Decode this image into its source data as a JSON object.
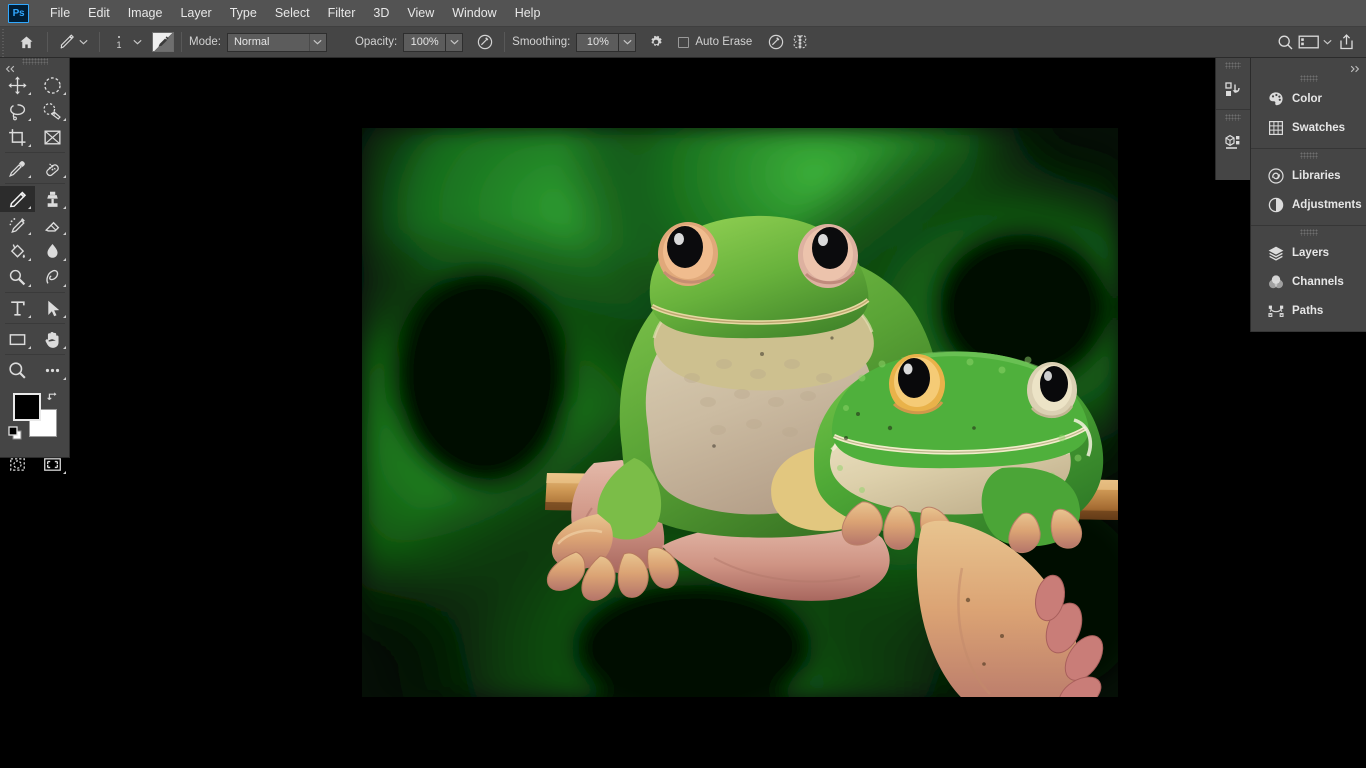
{
  "app": {
    "name": "Adobe Photoshop",
    "logo_text": "Ps",
    "accent_color": "#31a8ff",
    "chrome_color": "#535353",
    "panel_color": "#454545",
    "canvas_color": "#000000"
  },
  "menubar": {
    "items": [
      {
        "label": "File"
      },
      {
        "label": "Edit"
      },
      {
        "label": "Image"
      },
      {
        "label": "Layer"
      },
      {
        "label": "Type"
      },
      {
        "label": "Select"
      },
      {
        "label": "Filter"
      },
      {
        "label": "3D"
      },
      {
        "label": "View"
      },
      {
        "label": "Window"
      },
      {
        "label": "Help"
      }
    ]
  },
  "optionsbar": {
    "home_icon": "home-icon",
    "active_tool_icon": "pencil-tool-icon",
    "tool_preset_caret": "chevron-down-icon",
    "brush_size_value": "1",
    "brush_preset_caret": "chevron-down-icon",
    "brush_preset_icon": "brush-preset-icon",
    "mode_label": "Mode:",
    "mode_value": "Normal",
    "opacity_label": "Opacity:",
    "opacity_value": "100%",
    "opacity_pressure_icon": "pressure-opacity-icon",
    "smoothing_label": "Smoothing:",
    "smoothing_value": "10%",
    "smoothing_settings_icon": "gear-icon",
    "auto_erase_label": "Auto Erase",
    "auto_erase_checked": false,
    "pressure_size_icon": "pressure-size-icon",
    "symmetry_icon": "symmetry-butterfly-icon",
    "right_search_icon": "search-icon",
    "right_workspace_icon": "workspace-icon",
    "right_workspace_caret": "chevron-down-icon",
    "right_share_icon": "share-icon"
  },
  "toolbar": {
    "collapse_icon": "double-chevron-left-icon",
    "grip": "panel-grip",
    "tools": [
      {
        "name": "move-tool",
        "icon": "move-icon",
        "has_flyout": true,
        "active": false
      },
      {
        "name": "elliptical-marquee-tool",
        "icon": "elliptical-marquee-icon",
        "has_flyout": true,
        "active": false
      },
      {
        "name": "lasso-tool",
        "icon": "lasso-icon",
        "has_flyout": true,
        "active": false
      },
      {
        "name": "object-selection-tool",
        "icon": "quick-selection-icon",
        "has_flyout": true,
        "active": false
      },
      {
        "name": "crop-tool",
        "icon": "crop-icon",
        "has_flyout": true,
        "active": false
      },
      {
        "name": "frame-tool",
        "icon": "frame-icon",
        "has_flyout": false,
        "active": false
      },
      {
        "name": "eyedropper-tool",
        "icon": "eyedropper-icon",
        "has_flyout": true,
        "active": false
      },
      {
        "name": "spot-healing-brush-tool",
        "icon": "healing-brush-icon",
        "has_flyout": true,
        "active": false
      },
      {
        "name": "pencil-tool",
        "icon": "pencil-icon",
        "has_flyout": true,
        "active": true
      },
      {
        "name": "clone-stamp-tool",
        "icon": "clone-stamp-icon",
        "has_flyout": true,
        "active": false
      },
      {
        "name": "history-brush-tool",
        "icon": "history-brush-icon",
        "has_flyout": true,
        "active": false
      },
      {
        "name": "eraser-tool",
        "icon": "eraser-icon",
        "has_flyout": true,
        "active": false
      },
      {
        "name": "gradient-tool",
        "icon": "paint-bucket-icon",
        "has_flyout": true,
        "active": false
      },
      {
        "name": "blur-tool",
        "icon": "blur-droplet-icon",
        "has_flyout": true,
        "active": false
      },
      {
        "name": "dodge-tool",
        "icon": "dodge-icon",
        "has_flyout": true,
        "active": false
      },
      {
        "name": "pen-tool",
        "icon": "pen-icon",
        "has_flyout": true,
        "active": false
      },
      {
        "name": "horizontal-type-tool",
        "icon": "type-t-icon",
        "has_flyout": true,
        "active": false
      },
      {
        "name": "path-selection-tool",
        "icon": "path-arrow-icon",
        "has_flyout": true,
        "active": false
      },
      {
        "name": "rectangle-tool",
        "icon": "rectangle-icon",
        "has_flyout": true,
        "active": false
      },
      {
        "name": "hand-tool",
        "icon": "hand-icon",
        "has_flyout": true,
        "active": false
      },
      {
        "name": "zoom-tool",
        "icon": "zoom-magnifier-icon",
        "has_flyout": false,
        "active": false
      },
      {
        "name": "edit-toolbar",
        "icon": "ellipsis-icon",
        "has_flyout": true,
        "active": false
      }
    ],
    "colors": {
      "foreground": "#000000",
      "background": "#ffffff",
      "swap_icon": "swap-colors-icon",
      "default_icon": "default-colors-icon"
    },
    "bottom": [
      {
        "name": "quick-mask-mode",
        "icon": "quick-mask-icon"
      },
      {
        "name": "screen-mode",
        "icon": "screen-mode-icon"
      }
    ]
  },
  "dock": {
    "collapse_icon": "double-chevron-right-icon",
    "icon_column": [
      {
        "name": "history-panel-icon",
        "icon": "history-icon"
      },
      {
        "name": "3d-panel-icon",
        "icon": "cube-3d-icon"
      }
    ],
    "groups": [
      {
        "name": "color-group",
        "panels": [
          {
            "label": "Color",
            "icon": "color-palette-icon"
          },
          {
            "label": "Swatches",
            "icon": "swatches-grid-icon"
          }
        ]
      },
      {
        "name": "libraries-group",
        "panels": [
          {
            "label": "Libraries",
            "icon": "creative-cloud-icon"
          },
          {
            "label": "Adjustments",
            "icon": "adjustments-halfcircle-icon"
          }
        ]
      },
      {
        "name": "layers-group",
        "panels": [
          {
            "label": "Layers",
            "icon": "layers-stack-icon"
          },
          {
            "label": "Channels",
            "icon": "channels-icon"
          },
          {
            "label": "Paths",
            "icon": "paths-node-icon"
          }
        ]
      }
    ]
  },
  "document": {
    "name": "frogs-photo",
    "description": "Two white-lipped tree frogs perched on a bamboo stick against a blurred green bokeh background",
    "colors": {
      "background_green_dark": "#0a1c0c",
      "background_green_mid": "#1f7a24",
      "background_green_light": "#3faa3a",
      "branch_tan": "#c08a4a",
      "branch_light": "#e0b477",
      "frog_green": "#5aa83c",
      "frog_belly": "#d8c3ad",
      "frog_pink": "#d99a93"
    }
  }
}
